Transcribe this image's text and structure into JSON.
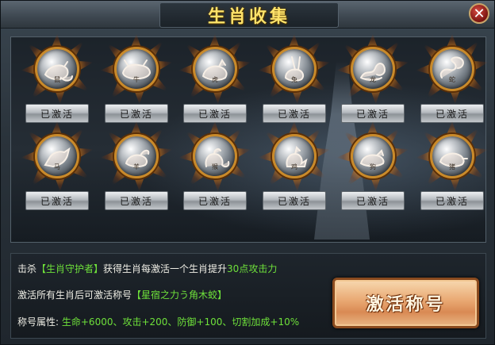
{
  "window": {
    "title": "生肖收集",
    "close_glyph": "✕"
  },
  "zodiac": {
    "slots": [
      {
        "animal": "rat-icon",
        "glyph": "鼠",
        "status": "已激活"
      },
      {
        "animal": "ox-icon",
        "glyph": "牛",
        "status": "已激活"
      },
      {
        "animal": "tiger-icon",
        "glyph": "虎",
        "status": "已激活"
      },
      {
        "animal": "rabbit-icon",
        "glyph": "兔",
        "status": "已激活"
      },
      {
        "animal": "dragon-icon",
        "glyph": "龙",
        "status": "已激活"
      },
      {
        "animal": "snake-icon",
        "glyph": "蛇",
        "status": "已激活"
      },
      {
        "animal": "horse-icon",
        "glyph": "马",
        "status": "已激活"
      },
      {
        "animal": "goat-icon",
        "glyph": "羊",
        "status": "已激活"
      },
      {
        "animal": "monkey-icon",
        "glyph": "猴",
        "status": "已激活"
      },
      {
        "animal": "rooster-icon",
        "glyph": "鸡",
        "status": "已激活"
      },
      {
        "animal": "dog-icon",
        "glyph": "狗",
        "status": "已激活"
      },
      {
        "animal": "pig-icon",
        "glyph": "猪",
        "status": "已激活"
      }
    ]
  },
  "info": {
    "line1_prefix": "击杀",
    "line1_target": "【生肖守护者】",
    "line1_mid": "获得生肖每激活一个生肖提升",
    "line1_bonus": "30点攻击力",
    "line2_prefix": "激活所有生肖后可激活称号",
    "line2_title": "【星宿之力う角木蛟】",
    "line3_label": "称号属性:",
    "line3_attrs": "生命+6000、攻击+200、防御+100、切割加成+10%"
  },
  "activate_button": {
    "label": "激活称号"
  },
  "colors": {
    "title": "#ffe36a",
    "bonus_green": "#6ee03a",
    "orb_gold": "#c98a2a"
  }
}
